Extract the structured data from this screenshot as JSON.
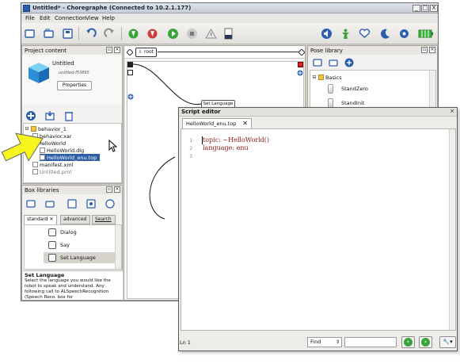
{
  "window": {
    "title": "Untitled* - Choregraphe (Connected to 10.2.1.177)",
    "controls": [
      "_",
      "□",
      "X"
    ]
  },
  "menu": [
    "File",
    "Edit",
    "Connection",
    "View",
    "Help"
  ],
  "toolbar": {
    "icons": [
      "new-icon",
      "open-icon",
      "save-icon",
      "undo-icon",
      "redo-icon",
      "connect-icon",
      "disconnect-icon",
      "play-icon",
      "stop-icon",
      "warning-icon",
      "volume-icon",
      "robot-icon",
      "heart-icon",
      "moon-icon",
      "settings-icon",
      "battery-icon"
    ],
    "battery_color": "#3bb33b",
    "accent": "#2b5fae"
  },
  "project": {
    "panel_title": "Project content",
    "name": "Untitled",
    "file": "untitled-f53895",
    "properties_label": "Properties",
    "tree": [
      {
        "label": "behavior_1",
        "type": "folder",
        "expanded": true
      },
      {
        "label": "behavior.xar",
        "type": "file"
      },
      {
        "label": "HelloWorld",
        "type": "folder",
        "expanded": true
      },
      {
        "label": "HelloWorld.dlg",
        "type": "file"
      },
      {
        "label": "HelloWorld_enu.top",
        "type": "file",
        "selected": true
      },
      {
        "label": "manifest.xml",
        "type": "file"
      },
      {
        "label": "Untitled.pml",
        "type": "file"
      }
    ]
  },
  "boxlib": {
    "panel_title": "Box libraries",
    "tabs": [
      "standard",
      "advanced",
      "Search"
    ],
    "items": [
      "Dialog",
      "Say",
      "Set Language"
    ],
    "desc_title": "Set Language",
    "desc_text": "Select the language you would like the robot to speak and understand. Any following call to ALSpeechRecognition (Speech Reco. box for"
  },
  "center": {
    "crumb": "root",
    "box_label": "Set Language"
  },
  "pose": {
    "panel_title": "Pose library",
    "group": "Basics",
    "items": [
      "StandZero",
      "StandInit"
    ]
  },
  "editor": {
    "title": "Script editor",
    "tab": "HelloWorld_enu.top",
    "lines": [
      "topic: ~HelloWorld()",
      "language: enu",
      ""
    ],
    "line_numbers": [
      "1",
      "2",
      "3"
    ],
    "status": "Ln 1",
    "find_label": "Find",
    "find_value": "",
    "tool_label": "🔧▾"
  }
}
